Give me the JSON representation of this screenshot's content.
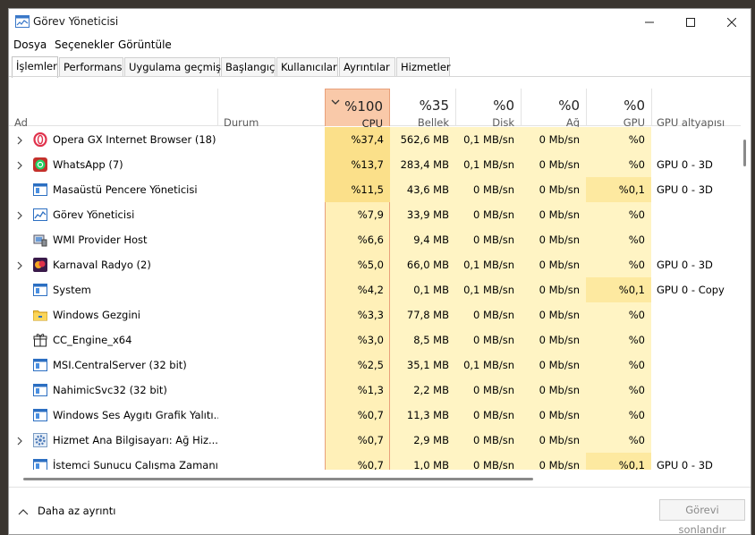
{
  "window": {
    "title": "Görev Yöneticisi"
  },
  "menu": [
    "Dosya",
    "Seçenekler",
    "Görüntüle"
  ],
  "tabs": [
    "İşlemler",
    "Performans",
    "Uygulama geçmişi",
    "Başlangıç",
    "Kullanıcılar",
    "Ayrıntılar",
    "Hizmetler"
  ],
  "columns": {
    "name": "Ad",
    "status": "Durum",
    "cpu": {
      "pct": "%100",
      "label": "CPU"
    },
    "mem": {
      "pct": "%35",
      "label": "Bellek"
    },
    "disk": {
      "pct": "%0",
      "label": "Disk"
    },
    "net": {
      "pct": "%0",
      "label": "Ağ"
    },
    "gpu": {
      "pct": "%0",
      "label": "GPU"
    },
    "engine": "GPU altyapısı"
  },
  "processes": [
    {
      "name": "Opera GX Internet Browser (18)",
      "icon": "opera-icon",
      "expandable": true,
      "cpu": "%37,4",
      "mem": "562,6 MB",
      "disk": "0,1 MB/sn",
      "net": "0 Mb/sn",
      "gpu": "%0",
      "engine": ""
    },
    {
      "name": "WhatsApp (7)",
      "icon": "whatsapp-icon",
      "expandable": true,
      "cpu": "%13,7",
      "mem": "283,4 MB",
      "disk": "0,1 MB/sn",
      "net": "0 Mb/sn",
      "gpu": "%0",
      "engine": "GPU 0 - 3D"
    },
    {
      "name": "Masaüstü Pencere Yöneticisi",
      "icon": "window-icon",
      "expandable": false,
      "cpu": "%11,5",
      "mem": "43,6 MB",
      "disk": "0 MB/sn",
      "net": "0 Mb/sn",
      "gpu": "%0,1",
      "engine": "GPU 0 - 3D"
    },
    {
      "name": "Görev Yöneticisi",
      "icon": "task-manager-icon",
      "expandable": true,
      "cpu": "%7,9",
      "mem": "33,9 MB",
      "disk": "0 MB/sn",
      "net": "0 Mb/sn",
      "gpu": "%0",
      "engine": ""
    },
    {
      "name": "WMI Provider Host",
      "icon": "wmi-icon",
      "expandable": false,
      "cpu": "%6,6",
      "mem": "9,4 MB",
      "disk": "0 MB/sn",
      "net": "0 Mb/sn",
      "gpu": "%0",
      "engine": ""
    },
    {
      "name": "Karnaval Radyo (2)",
      "icon": "radio-icon",
      "expandable": true,
      "cpu": "%5,0",
      "mem": "66,0 MB",
      "disk": "0,1 MB/sn",
      "net": "0 Mb/sn",
      "gpu": "%0",
      "engine": "GPU 0 - 3D"
    },
    {
      "name": "System",
      "icon": "window-icon",
      "expandable": false,
      "cpu": "%4,2",
      "mem": "0,1 MB",
      "disk": "0,1 MB/sn",
      "net": "0 Mb/sn",
      "gpu": "%0,1",
      "engine": "GPU 0 - Copy"
    },
    {
      "name": "Windows Gezgini",
      "icon": "folder-icon",
      "expandable": false,
      "cpu": "%3,3",
      "mem": "77,8 MB",
      "disk": "0 MB/sn",
      "net": "0 Mb/sn",
      "gpu": "%0",
      "engine": ""
    },
    {
      "name": "CC_Engine_x64",
      "icon": "gift-icon",
      "expandable": false,
      "cpu": "%3,0",
      "mem": "8,5 MB",
      "disk": "0 MB/sn",
      "net": "0 Mb/sn",
      "gpu": "%0",
      "engine": ""
    },
    {
      "name": "MSI.CentralServer (32 bit)",
      "icon": "window-icon",
      "expandable": false,
      "cpu": "%2,5",
      "mem": "35,1 MB",
      "disk": "0,1 MB/sn",
      "net": "0 Mb/sn",
      "gpu": "%0",
      "engine": ""
    },
    {
      "name": "NahimicSvc32 (32 bit)",
      "icon": "window-icon",
      "expandable": false,
      "cpu": "%1,3",
      "mem": "2,2 MB",
      "disk": "0 MB/sn",
      "net": "0 Mb/sn",
      "gpu": "%0",
      "engine": ""
    },
    {
      "name": "Windows Ses Aygıtı Grafik Yalıtı...",
      "icon": "window-icon",
      "expandable": false,
      "cpu": "%0,7",
      "mem": "11,3 MB",
      "disk": "0 MB/sn",
      "net": "0 Mb/sn",
      "gpu": "%0",
      "engine": ""
    },
    {
      "name": "Hizmet Ana Bilgisayarı: Ağ Hiz...",
      "icon": "gear-icon",
      "expandable": true,
      "cpu": "%0,7",
      "mem": "2,9 MB",
      "disk": "0 MB/sn",
      "net": "0 Mb/sn",
      "gpu": "%0",
      "engine": ""
    },
    {
      "name": "İstemci Sunucu Çalışma Zamanı...",
      "icon": "window-icon",
      "expandable": false,
      "cpu": "%0,7",
      "mem": "1,0 MB",
      "disk": "0 MB/sn",
      "net": "0 Mb/sn",
      "gpu": "%0,1",
      "engine": "GPU 0 - 3D"
    }
  ],
  "footer": {
    "less_details": "Daha az ayrıntı",
    "end_task": "Görevi sonlandır"
  },
  "colors": {
    "cpu_header": "#f9c9a9",
    "cpu_column": "#fff0b8",
    "column_heat": "#fff4c4",
    "high_usage": "#fbe08a"
  }
}
